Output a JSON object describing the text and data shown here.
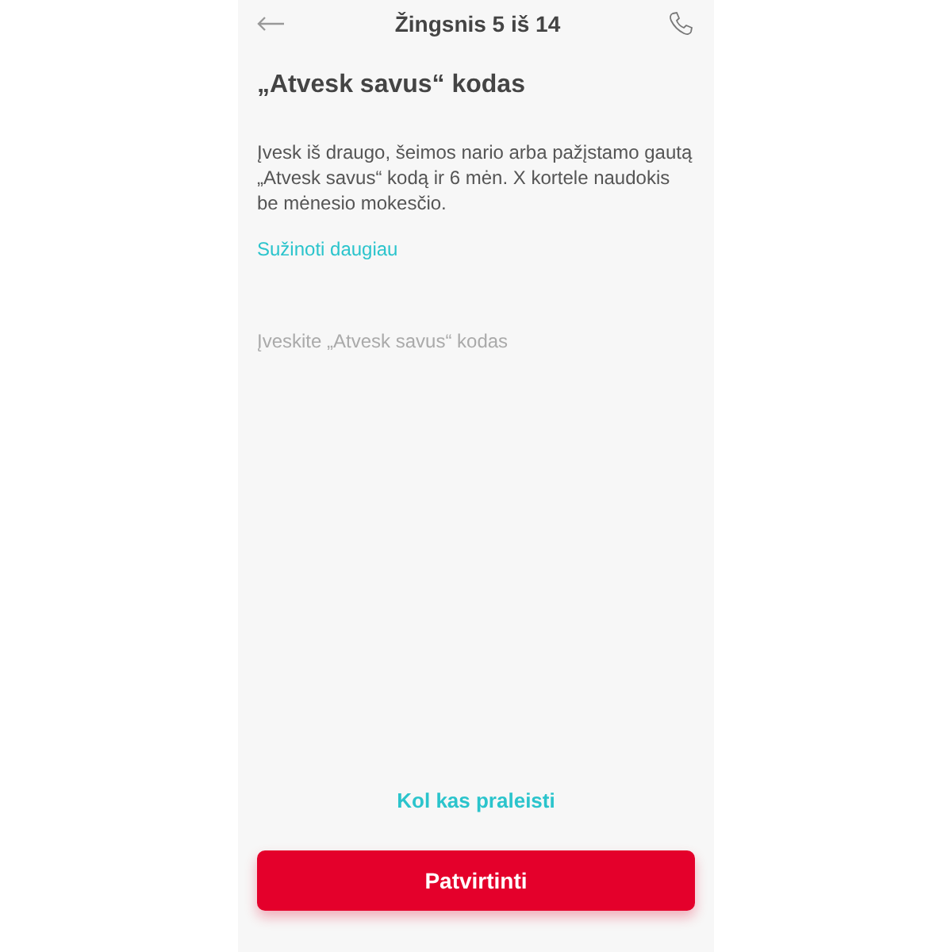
{
  "header": {
    "title": "Žingsnis 5 iš 14"
  },
  "heading": "„Atvesk savus“ kodas",
  "description": "Įvesk iš draugo, šeimos nario arba pažįstamo gautą „Atvesk savus“ kodą ir 6 mėn. X kortele naudokis be mėnesio mokesčio.",
  "learn_more_link": "Sužinoti daugiau",
  "code_field": {
    "placeholder": "Įveskite „Atvesk savus“ kodas"
  },
  "skip_link": "Kol kas praleisti",
  "confirm_button": "Patvirtinti"
}
